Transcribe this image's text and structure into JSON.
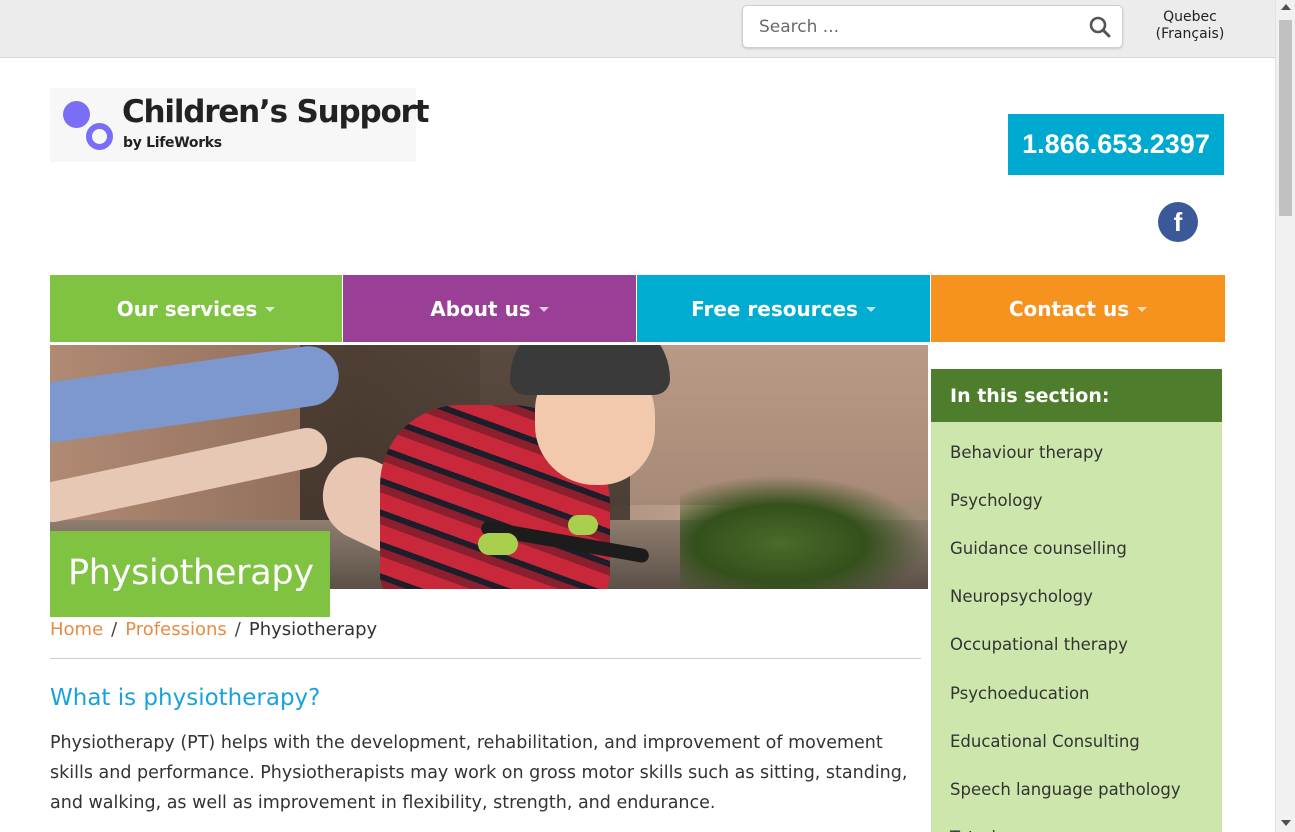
{
  "search": {
    "placeholder": "Search ..."
  },
  "language": {
    "line1": "Quebec",
    "line2": "(Français)"
  },
  "logo": {
    "title": "Children’s Support",
    "subtitle": "by LifeWorks"
  },
  "phone": "1.866.653.2397",
  "social": {
    "facebook_glyph": "f"
  },
  "nav": [
    {
      "label": "Our services",
      "color": "#80c342"
    },
    {
      "label": "About us",
      "color": "#9a3f96"
    },
    {
      "label": "Free resources",
      "color": "#00add0"
    },
    {
      "label": "Contact us",
      "color": "#f6921e"
    }
  ],
  "page_title": "Physiotherapy",
  "breadcrumb": {
    "home": "Home",
    "professions": "Professions",
    "current": "Physiotherapy",
    "separator": "/"
  },
  "content": {
    "heading": "What is physiotherapy?",
    "paragraph": "Physiotherapy (PT) helps with the development, rehabilitation, and improvement of movement skills and performance. Physiotherapists may work on gross motor skills such as sitting, standing, and walking, as well as improvement in flexibility, strength, and endurance."
  },
  "sidebar": {
    "heading": "In this section:",
    "items": [
      "Behaviour therapy",
      "Psychology",
      "Guidance counselling",
      "Neuropsychology",
      "Occupational therapy",
      "Psychoeducation",
      "Educational Consulting",
      "Speech language pathology",
      "Tutoring"
    ]
  },
  "colors": {
    "green": "#80c342",
    "purple": "#9a3f96",
    "blue": "#00add0",
    "orange": "#f6921e",
    "sidebar_head": "#4e7d2b",
    "sidebar_bg": "#cce6ab",
    "link_orange": "#e98b43",
    "heading_blue": "#1aa2db"
  }
}
